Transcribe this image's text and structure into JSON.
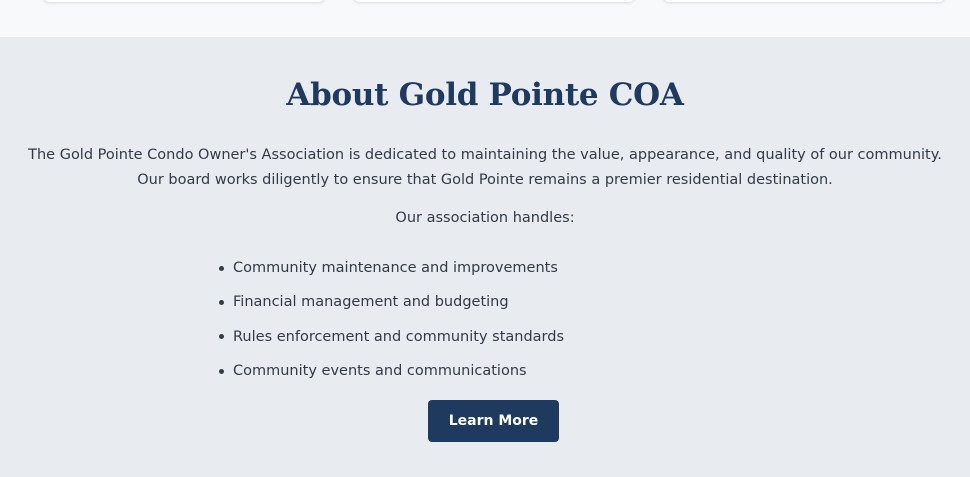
{
  "about": {
    "title": "About Gold Pointe COA",
    "description": [
      "The Gold Pointe Condo Owner's Association is dedicated to maintaining the value, appearance, and quality of our community.",
      "Our board works diligently to ensure that Gold Pointe remains a premier residential destination."
    ],
    "handles_label": "Our association handles:",
    "duties": [
      "Community maintenance and improvements",
      "Financial management and budgeting",
      "Rules enforcement and community standards",
      "Community events and communications"
    ],
    "button_label": "Learn More"
  },
  "colors": {
    "heading": "#1e3a5f",
    "button_bg": "#1e3a5f",
    "section_bg": "#e8ecf0",
    "text": "#333a44"
  }
}
